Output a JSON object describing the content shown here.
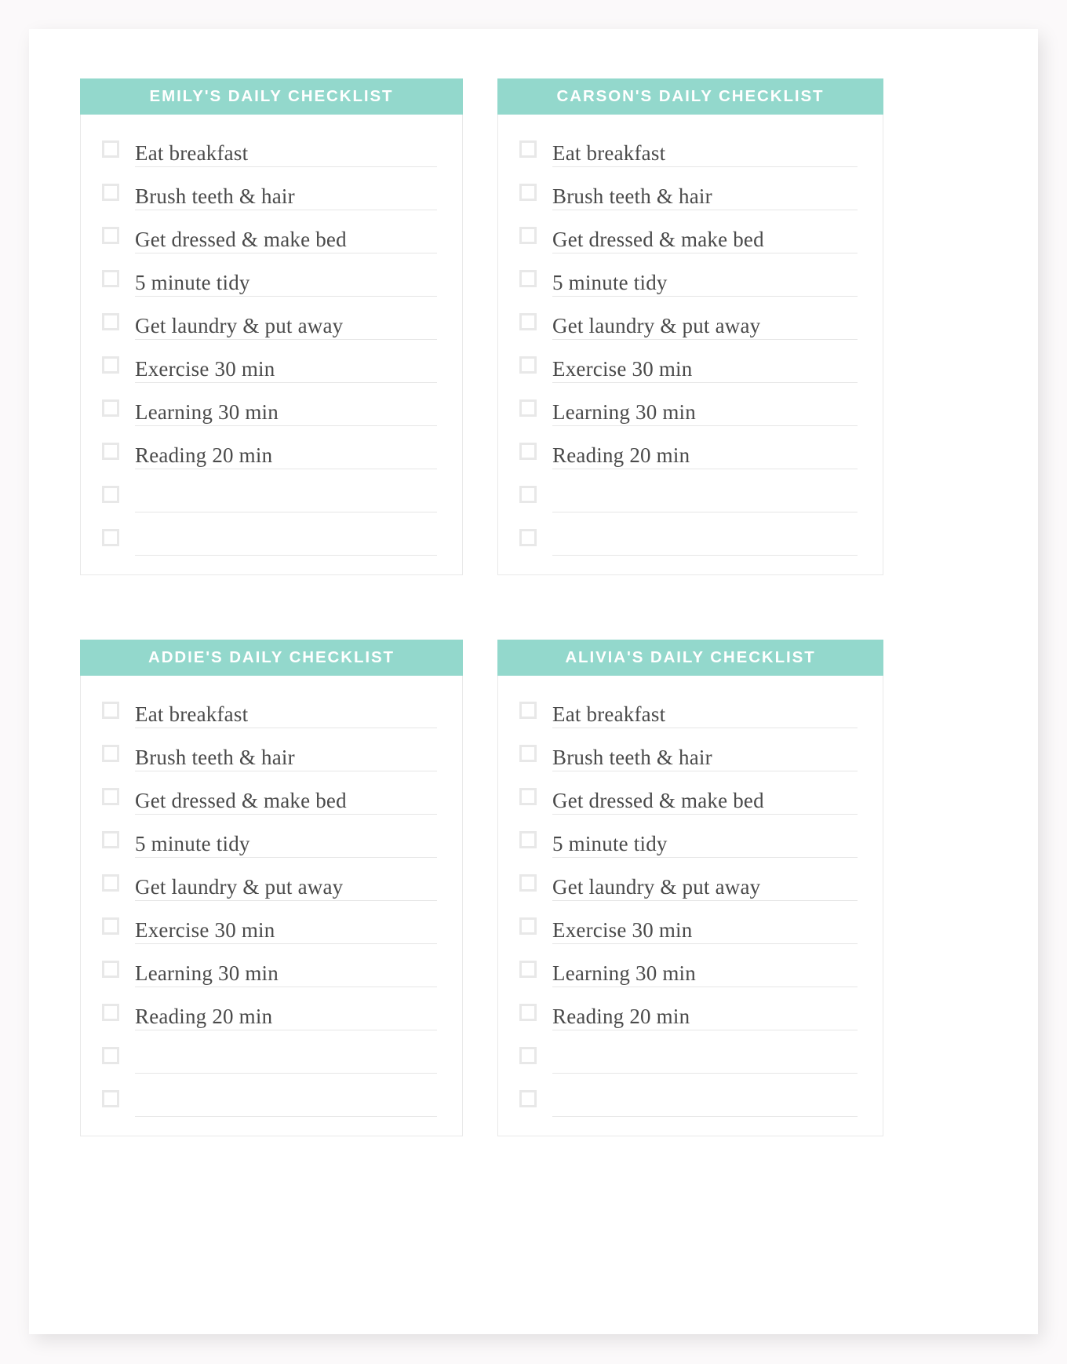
{
  "document": {
    "type": "printable-checklist-sheet",
    "background_color": "#fbf9fa",
    "sheet_color": "#ffffff",
    "accent_color": "#93d8cc",
    "text_color": "#4a4a4a",
    "rule_color": "#e6e6e6",
    "checkbox_border_color": "#e8e8e8"
  },
  "cards": [
    {
      "id": "emily",
      "title": "EMILY'S DAILY CHECKLIST",
      "items": [
        {
          "label": "Eat breakfast",
          "checked": false
        },
        {
          "label": "Brush teeth & hair",
          "checked": false
        },
        {
          "label": "Get dressed & make bed",
          "checked": false
        },
        {
          "label": "5 minute tidy",
          "checked": false
        },
        {
          "label": "Get laundry & put away",
          "checked": false
        },
        {
          "label": "Exercise 30 min",
          "checked": false
        },
        {
          "label": "Learning 30 min",
          "checked": false
        },
        {
          "label": "Reading 20 min",
          "checked": false
        },
        {
          "label": "",
          "checked": false
        },
        {
          "label": "",
          "checked": false
        }
      ]
    },
    {
      "id": "carson",
      "title": "CARSON'S DAILY CHECKLIST",
      "items": [
        {
          "label": "Eat breakfast",
          "checked": false
        },
        {
          "label": "Brush teeth & hair",
          "checked": false
        },
        {
          "label": "Get dressed & make bed",
          "checked": false
        },
        {
          "label": "5 minute tidy",
          "checked": false
        },
        {
          "label": "Get laundry & put away",
          "checked": false
        },
        {
          "label": "Exercise 30 min",
          "checked": false
        },
        {
          "label": "Learning 30 min",
          "checked": false
        },
        {
          "label": "Reading 20 min",
          "checked": false
        },
        {
          "label": "",
          "checked": false
        },
        {
          "label": "",
          "checked": false
        }
      ]
    },
    {
      "id": "addie",
      "title": "ADDIE'S DAILY CHECKLIST",
      "items": [
        {
          "label": "Eat breakfast",
          "checked": false
        },
        {
          "label": "Brush teeth & hair",
          "checked": false
        },
        {
          "label": "Get dressed & make bed",
          "checked": false
        },
        {
          "label": "5 minute tidy",
          "checked": false
        },
        {
          "label": "Get laundry & put away",
          "checked": false
        },
        {
          "label": "Exercise 30 min",
          "checked": false
        },
        {
          "label": "Learning 30 min",
          "checked": false
        },
        {
          "label": "Reading 20 min",
          "checked": false
        },
        {
          "label": "",
          "checked": false
        },
        {
          "label": "",
          "checked": false
        }
      ]
    },
    {
      "id": "alivia",
      "title": "ALIVIA'S DAILY CHECKLIST",
      "items": [
        {
          "label": "Eat breakfast",
          "checked": false
        },
        {
          "label": "Brush teeth & hair",
          "checked": false
        },
        {
          "label": "Get dressed & make bed",
          "checked": false
        },
        {
          "label": "5 minute tidy",
          "checked": false
        },
        {
          "label": "Get laundry & put away",
          "checked": false
        },
        {
          "label": "Exercise 30 min",
          "checked": false
        },
        {
          "label": "Learning 30 min",
          "checked": false
        },
        {
          "label": "Reading 20 min",
          "checked": false
        },
        {
          "label": "",
          "checked": false
        },
        {
          "label": "",
          "checked": false
        }
      ]
    }
  ]
}
